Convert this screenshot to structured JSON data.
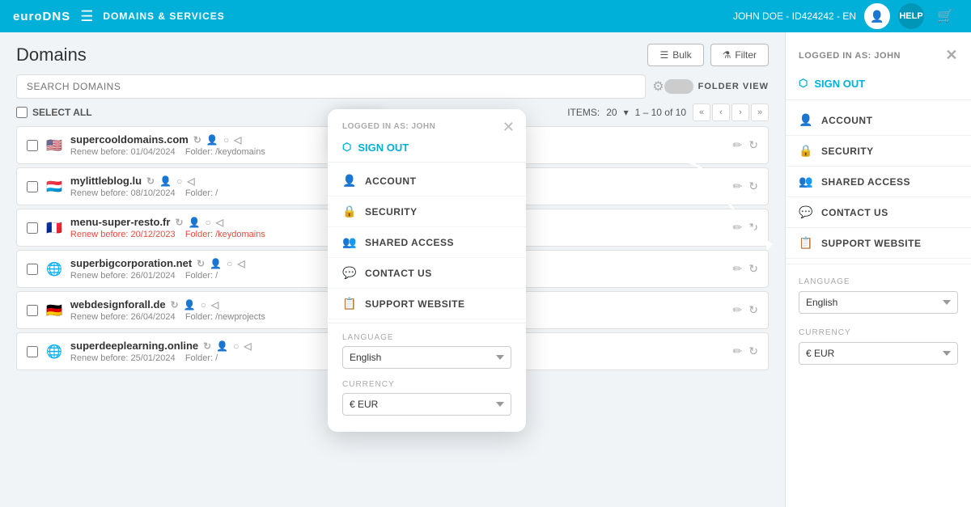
{
  "app": {
    "logo": "euroDNS",
    "nav_section": "DOMAINS & SERVICES",
    "user_info": "JOHN DOE - ID424242 - EN",
    "help_btn": "HELP"
  },
  "domains_page": {
    "title": "Domains",
    "bulk_btn": "Bulk",
    "filter_btn": "Filter",
    "search_placeholder": "SEARCH DOMAINS",
    "select_all": "SELECT ALL",
    "items_label": "ITEMS:",
    "items_count": "20",
    "pagination": "1 – 10 of 10",
    "folder_view": "FOLDER VIEW"
  },
  "domains": [
    {
      "name": "supercooldomains.com",
      "flag": "🇺🇸",
      "renew": "Renew before: 01/04/2024",
      "folder": "Folder: /keydomains",
      "overdue": false
    },
    {
      "name": "mylittleblog.lu",
      "flag": "🇱🇺",
      "renew": "Renew before: 08/10/2024",
      "folder": "Folder: /",
      "overdue": false
    },
    {
      "name": "menu-super-resto.fr",
      "flag": "🇫🇷",
      "renew": "Renew before: 20/12/2023",
      "folder": "Folder: /keydomains",
      "overdue": true
    },
    {
      "name": "superbigcorporation.net",
      "flag": "🌐",
      "renew": "Renew before: 26/01/2024",
      "folder": "Folder: /",
      "overdue": false
    },
    {
      "name": "webdesignforall.de",
      "flag": "🇩🇪",
      "renew": "Renew before: 26/04/2024",
      "folder": "Folder: /newprojects",
      "overdue": false
    },
    {
      "name": "superdeeplearning.online",
      "flag": "🌐",
      "renew": "Renew before: 25/01/2024",
      "folder": "Folder: /",
      "overdue": false
    }
  ],
  "right_sidebar": {
    "logged_as_label": "LOGGED IN AS:",
    "logged_as_user": "JOHN",
    "sign_out": "SIGN OUT",
    "menu_items": [
      {
        "id": "account",
        "label": "ACCOUNT",
        "icon": "👤"
      },
      {
        "id": "security",
        "label": "SECURITY",
        "icon": "🔒"
      },
      {
        "id": "shared_access",
        "label": "SHARED ACCESS",
        "icon": "👥"
      },
      {
        "id": "contact_us",
        "label": "CONTACT US",
        "icon": "💬"
      },
      {
        "id": "support_website",
        "label": "SUPPORT WEBSITE",
        "icon": "📋"
      }
    ],
    "language_label": "LANGUAGE",
    "language_value": "English",
    "currency_label": "CURRENCY",
    "currency_value": "€ EUR"
  },
  "popup": {
    "logged_as_label": "LOGGED IN AS: JOHN",
    "sign_out": "SIGN OUT",
    "menu_items": [
      {
        "id": "account",
        "label": "ACCOUNT",
        "icon": "👤"
      },
      {
        "id": "security",
        "label": "SECURITY",
        "icon": "🔒"
      },
      {
        "id": "shared_access",
        "label": "SHARED ACCESS",
        "icon": "👥"
      },
      {
        "id": "contact_us",
        "label": "CONTACT US",
        "icon": "💬"
      },
      {
        "id": "support_website",
        "label": "SUPPORT WEBSITE",
        "icon": "📋"
      }
    ],
    "language_label": "LANGUAGE",
    "language_value": "English",
    "currency_label": "CURRENCY",
    "currency_value": "€ EUR"
  }
}
